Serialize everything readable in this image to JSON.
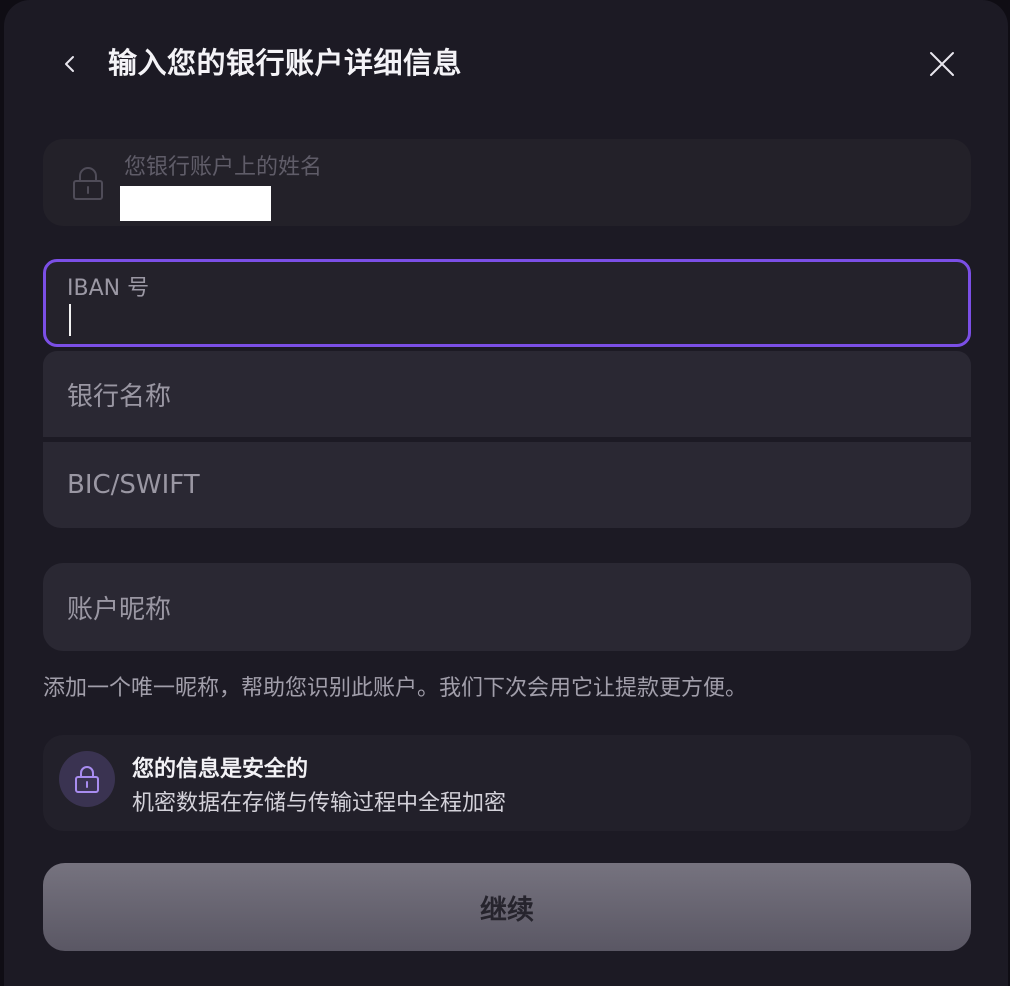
{
  "header": {
    "title": "输入您的银行账户详细信息"
  },
  "icons": {
    "back": "chevron-left-icon",
    "close": "close-icon",
    "field_lock": "lock-icon",
    "secure_lock": "lock-icon"
  },
  "form": {
    "account_name": {
      "label": "您银行账户上的姓名",
      "value_redacted": true
    },
    "iban": {
      "label": "IBAN 号",
      "value": ""
    },
    "bank_name": {
      "placeholder": "银行名称"
    },
    "bic_swift": {
      "placeholder": "BIC/SWIFT"
    },
    "nickname": {
      "placeholder": "账户昵称",
      "hint": "添加一个唯一昵称，帮助您识别此账户。我们下次会用它让提款更方便。"
    }
  },
  "security": {
    "title": "您的信息是安全的",
    "description": "机密数据在存储与传输过程中全程加密"
  },
  "actions": {
    "continue_label": "继续"
  },
  "colors": {
    "accent": "#7b4fe6",
    "modal_bg": "#1c1a24",
    "field_bg": "#2a2833",
    "button_bg": "#6a6773"
  }
}
